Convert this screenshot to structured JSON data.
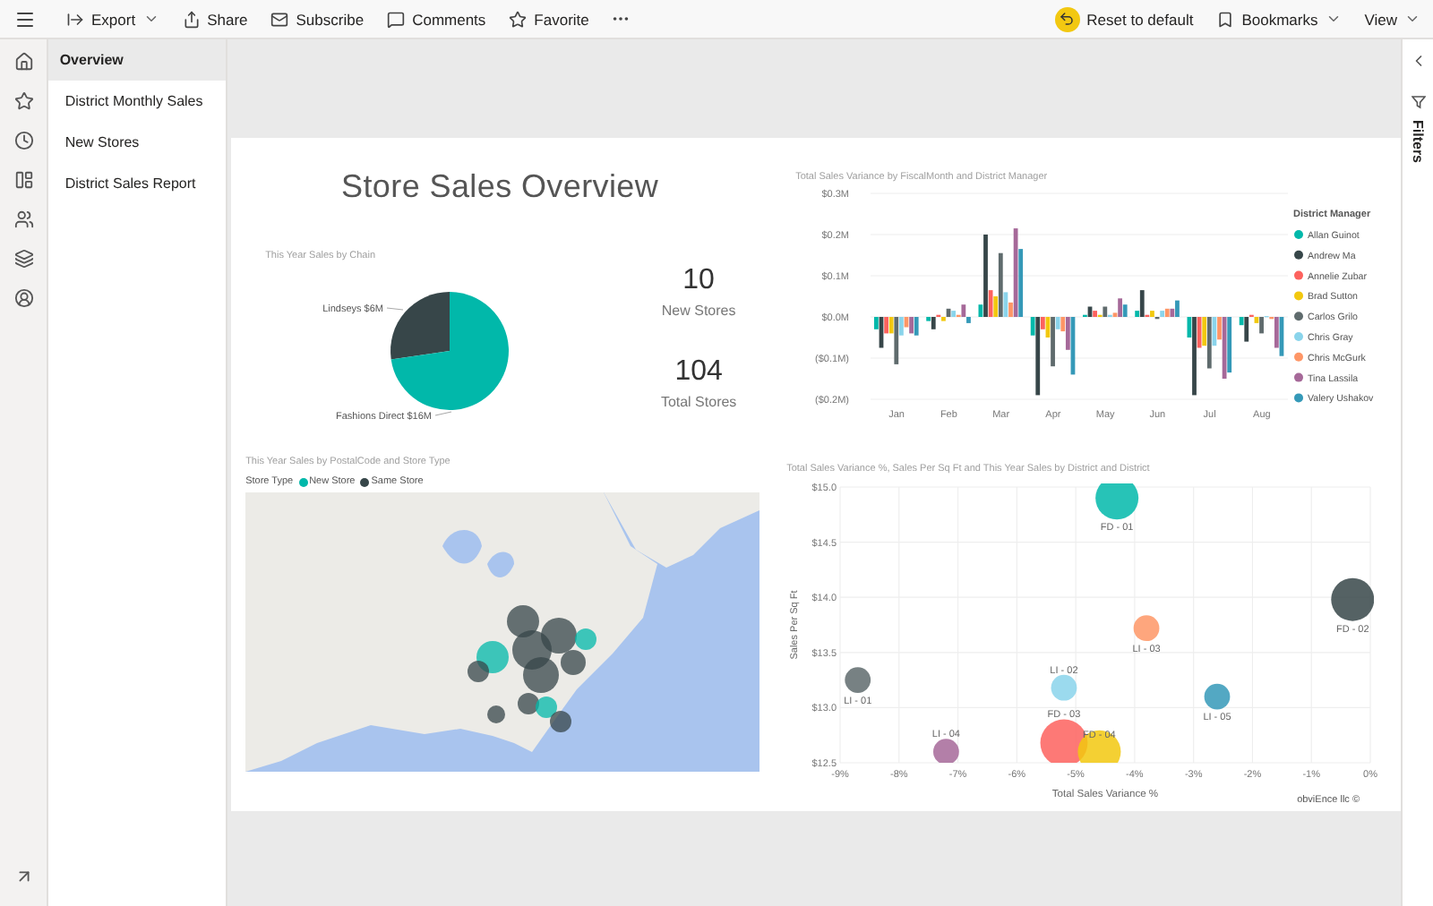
{
  "app_bar": {
    "left_actions": [
      {
        "kind": "export",
        "label": "Export",
        "has_menu": true
      },
      {
        "kind": "share",
        "label": "Share",
        "has_menu": false
      },
      {
        "kind": "subscribe",
        "label": "Subscribe",
        "has_menu": false
      },
      {
        "kind": "comments",
        "label": "Comments",
        "has_menu": false
      },
      {
        "kind": "favorite",
        "label": "Favorite",
        "has_menu": false
      },
      {
        "kind": "more"
      }
    ],
    "right_actions": [
      {
        "kind": "reset",
        "label": "Reset to default",
        "has_menu": false
      },
      {
        "kind": "bookmark",
        "label": "Bookmarks",
        "has_menu": true
      },
      {
        "kind": "view",
        "label": "View",
        "has_menu": true
      }
    ]
  },
  "nav_rail": {
    "items": [
      {
        "kind": "home"
      },
      {
        "kind": "favorites"
      },
      {
        "kind": "recent"
      },
      {
        "kind": "apps"
      },
      {
        "kind": "shared"
      },
      {
        "kind": "workspaces"
      },
      {
        "kind": "account"
      }
    ],
    "footer": {
      "kind": "expand"
    }
  },
  "pages": [
    {
      "label": "Overview",
      "selected": true
    },
    {
      "label": "District Monthly Sales",
      "selected": false
    },
    {
      "label": "New Stores",
      "selected": false
    },
    {
      "label": "District Sales Report",
      "selected": false
    }
  ],
  "report": {
    "title": "Store Sales Overview",
    "pie_visual": {
      "chart_data": {
        "type": "pie",
        "title": "This Year Sales by Chain",
        "categories": [
          "Lindseys",
          "Fashions Direct"
        ],
        "values": [
          6,
          16
        ],
        "value_labels": [
          "$6M",
          "$16M"
        ]
      }
    },
    "cards": [
      {
        "value": "10",
        "label": "New Stores"
      },
      {
        "value": "104",
        "label": "Total Stores"
      }
    ],
    "bar_visual": {
      "chart_data": {
        "type": "bar",
        "title": "Total Sales Variance by FiscalMonth and District Manager",
        "grid": true,
        "legend": {
          "title": "District Manager"
        },
        "categories": [
          "Jan",
          "Feb",
          "Mar",
          "Apr",
          "May",
          "Jun",
          "Jul",
          "Aug"
        ],
        "ylim": [
          -0.2,
          0.3
        ],
        "yticks": [
          {
            "value": 0.3,
            "label": "$0.3M"
          },
          {
            "value": 0.2,
            "label": "$0.2M"
          },
          {
            "value": 0.1,
            "label": "$0.1M"
          },
          {
            "value": 0,
            "label": "$0.0M"
          },
          {
            "value": -0.1,
            "label": "($0.1M)"
          },
          {
            "value": -0.2,
            "label": "($0.2M)"
          }
        ],
        "series": [
          {
            "name": "Allan Guinot",
            "color": "#01b8aa",
            "values": [
              -0.03,
              -0.01,
              0.03,
              -0.045,
              0.005,
              0.015,
              -0.05,
              -0.02
            ]
          },
          {
            "name": "Andrew Ma",
            "color": "#374649",
            "values": [
              -0.075,
              -0.03,
              0.2,
              -0.19,
              0.025,
              0.065,
              -0.19,
              -0.06
            ]
          },
          {
            "name": "Annelie Zubar",
            "color": "#fd625e",
            "values": [
              -0.04,
              0.005,
              0.065,
              -0.03,
              0.015,
              0.005,
              -0.075,
              0.005
            ]
          },
          {
            "name": "Brad Sutton",
            "color": "#f2c80f",
            "values": [
              -0.04,
              -0.01,
              0.05,
              -0.05,
              0.005,
              0.015,
              -0.07,
              -0.015
            ]
          },
          {
            "name": "Carlos Grilo",
            "color": "#5f6b6d",
            "values": [
              -0.115,
              0.02,
              0.155,
              -0.12,
              0.025,
              -0.005,
              -0.125,
              -0.04
            ]
          },
          {
            "name": "Chris Gray",
            "color": "#8ad4eb",
            "values": [
              -0.045,
              0.015,
              0.06,
              -0.03,
              0.005,
              0.015,
              -0.07,
              0.002
            ]
          },
          {
            "name": "Chris McGurk",
            "color": "#fe9666",
            "values": [
              -0.025,
              0.005,
              0.035,
              -0.035,
              0.01,
              0.02,
              -0.055,
              -0.005
            ]
          },
          {
            "name": "Tina Lassila",
            "color": "#a66999",
            "values": [
              -0.04,
              0.03,
              0.215,
              -0.08,
              0.045,
              0.02,
              -0.15,
              -0.075
            ]
          },
          {
            "name": "Valery Ushakov",
            "color": "#3599b8",
            "values": [
              -0.045,
              -0.015,
              0.165,
              -0.14,
              0.03,
              0.04,
              -0.135,
              -0.095
            ]
          }
        ]
      }
    },
    "map_visual": {
      "title": "This Year Sales by PostalCode and Store Type",
      "legend": {
        "title": "Store Type",
        "items": [
          {
            "label": "New Store",
            "color": "#01b8aa"
          },
          {
            "label": "Same Store",
            "color": "#374649"
          }
        ]
      },
      "kind": "picture"
    },
    "scatter_visual": {
      "credit": "obviEnce llc ©",
      "chart_data": {
        "type": "scatter",
        "title": "Total Sales Variance %, Sales Per Sq Ft and This Year Sales by District and District",
        "xlabel": "Total Sales Variance %",
        "ylabel": "Sales Per Sq Ft",
        "xlim": [
          -9,
          0
        ],
        "ylim": [
          12.5,
          15
        ],
        "grid": true,
        "xticks": [
          {
            "value": -9,
            "label": "-9%"
          },
          {
            "value": -8,
            "label": "-8%"
          },
          {
            "value": -7,
            "label": "-7%"
          },
          {
            "value": -6,
            "label": "-6%"
          },
          {
            "value": -5,
            "label": "-5%"
          },
          {
            "value": -4,
            "label": "-4%"
          },
          {
            "value": -3,
            "label": "-3%"
          },
          {
            "value": -2,
            "label": "-2%"
          },
          {
            "value": -1,
            "label": "-1%"
          },
          {
            "value": 0,
            "label": "0%"
          }
        ],
        "yticks": [
          {
            "value": 12.5,
            "label": "$12.5"
          },
          {
            "value": 13,
            "label": "$13.0"
          },
          {
            "value": 13.5,
            "label": "$13.5"
          },
          {
            "value": 14,
            "label": "$14.0"
          },
          {
            "value": 14.5,
            "label": "$14.5"
          },
          {
            "value": 15,
            "label": "$15.0"
          }
        ],
        "series": [
          {
            "name": "FD - 01",
            "color": "#01b8aa",
            "x": [
              -4.3
            ],
            "values": [
              14.9
            ]
          },
          {
            "name": "FD - 02",
            "color": "#374649",
            "x": [
              -0.3
            ],
            "values": [
              13.98
            ]
          },
          {
            "name": "LI - 03",
            "color": "#fe9666",
            "x": [
              -3.8
            ],
            "values": [
              13.72
            ]
          },
          {
            "name": "LI - 02",
            "color": "#8ad4eb",
            "x": [
              -5.2
            ],
            "values": [
              13.18
            ]
          },
          {
            "name": "LI - 01",
            "color": "#5f6b6d",
            "x": [
              -8.7
            ],
            "values": [
              13.25
            ]
          },
          {
            "name": "LI - 05",
            "color": "#3599b8",
            "x": [
              -2.6
            ],
            "values": [
              13.1
            ]
          },
          {
            "name": "FD - 03",
            "color": "#fd625e",
            "x": [
              -5.2
            ],
            "values": [
              12.68
            ]
          },
          {
            "name": "FD - 04",
            "color": "#f2c80f",
            "x": [
              -4.6
            ],
            "values": [
              12.6
            ]
          },
          {
            "name": "LI - 04",
            "color": "#a66999",
            "x": [
              -7.2
            ],
            "values": [
              12.6
            ]
          }
        ]
      }
    }
  },
  "filters_pane": {
    "label": "Filters"
  }
}
